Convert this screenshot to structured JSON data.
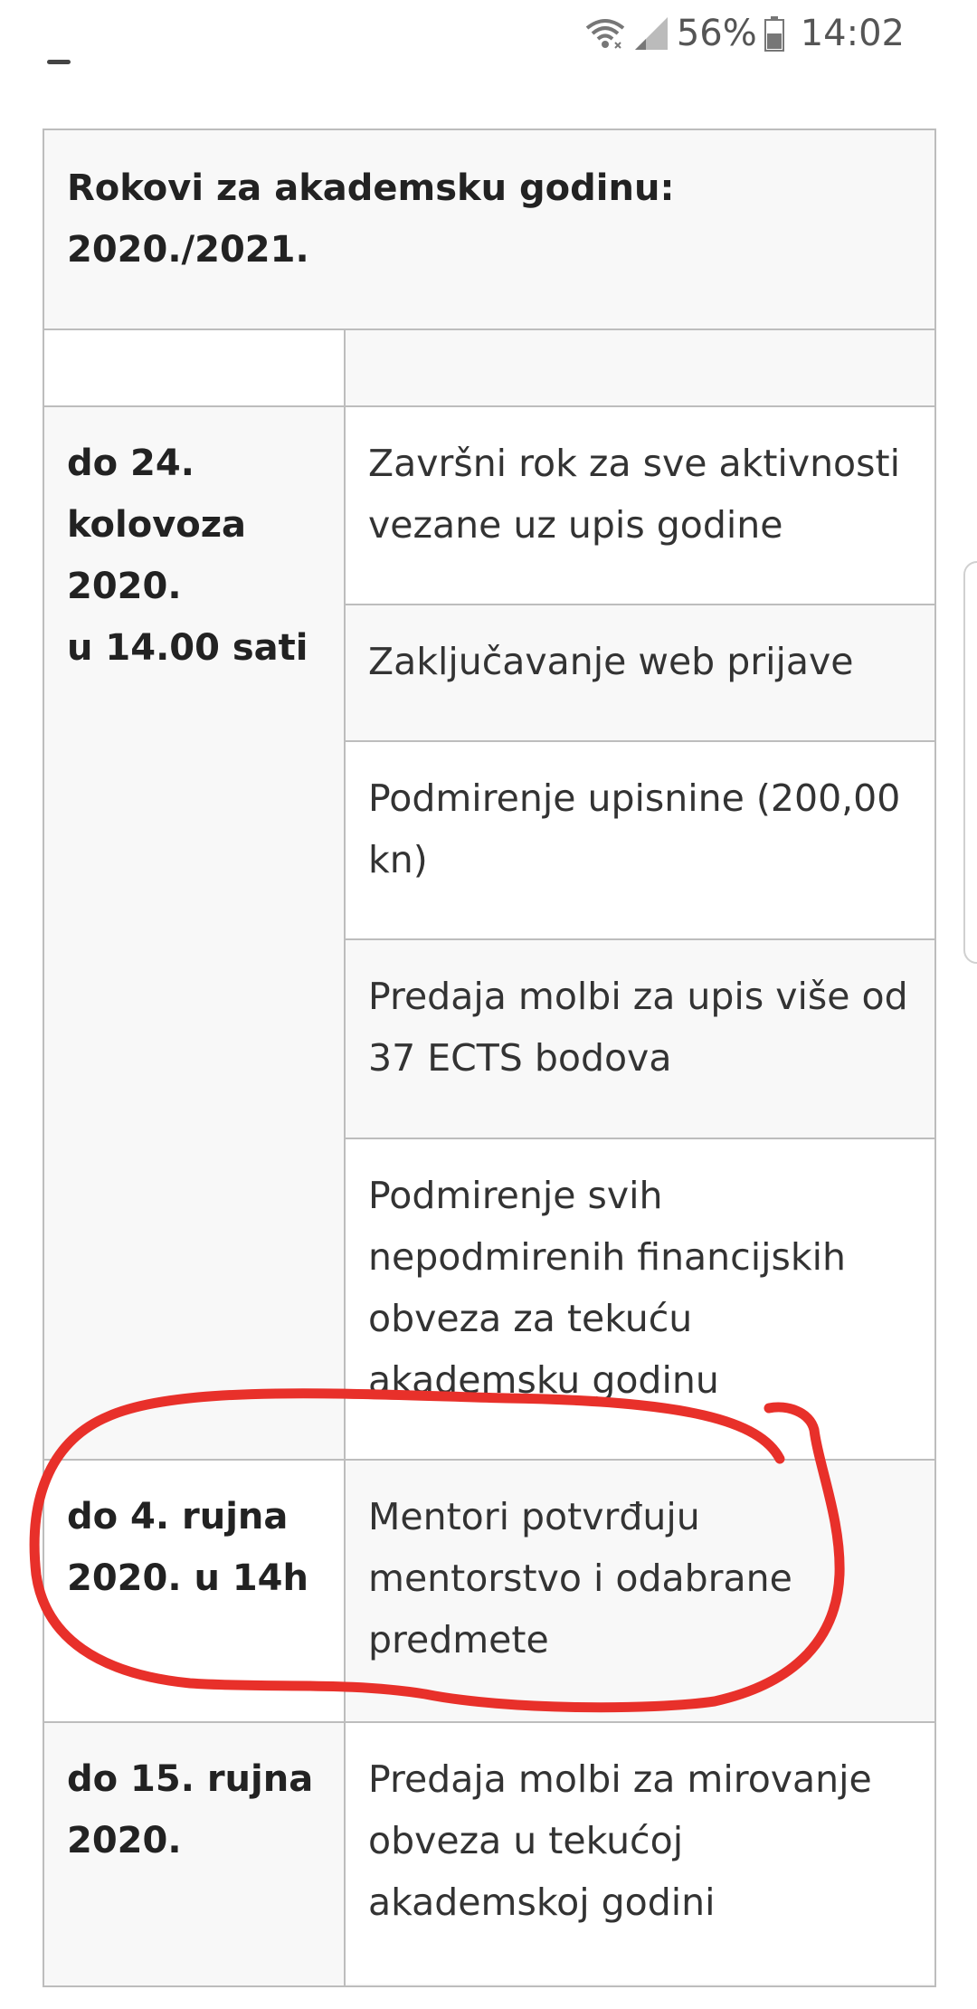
{
  "status_bar": {
    "battery": "56%",
    "time": "14:02",
    "icons": [
      "wifi-icon",
      "signal-icon",
      "battery-icon"
    ]
  },
  "table": {
    "title": "Rokovi za akademsku godinu:\n2020./2021.",
    "rows": [
      {
        "date": "",
        "items": [
          ""
        ]
      },
      {
        "date": "do 24.\nkolovoza\n2020.\nu 14.00 sati",
        "items": [
          "Završni rok za sve aktivnosti vezane uz upis godine",
          "Zaključavanje web prijave",
          "Podmirenje upisnine (200,00 kn)",
          "Predaja molbi za upis više od 37 ECTS bodova",
          "Podmirenje svih nepodmirenih financijskih obveza za tekuću akademsku godinu"
        ]
      },
      {
        "date": "do 4. rujna\n2020. u 14h",
        "items": [
          "Mentori potvrđuju mentorstvo i odabrane predmete"
        ]
      },
      {
        "date": "do 15. rujna\n2020.",
        "items": [
          "Predaja molbi za mirovanje obveza u tekućoj akademskoj godini"
        ]
      }
    ]
  },
  "colors": {
    "annotation": "#e8302a",
    "border": "#bdbdbd",
    "cell_gray": "#f8f8f8"
  }
}
